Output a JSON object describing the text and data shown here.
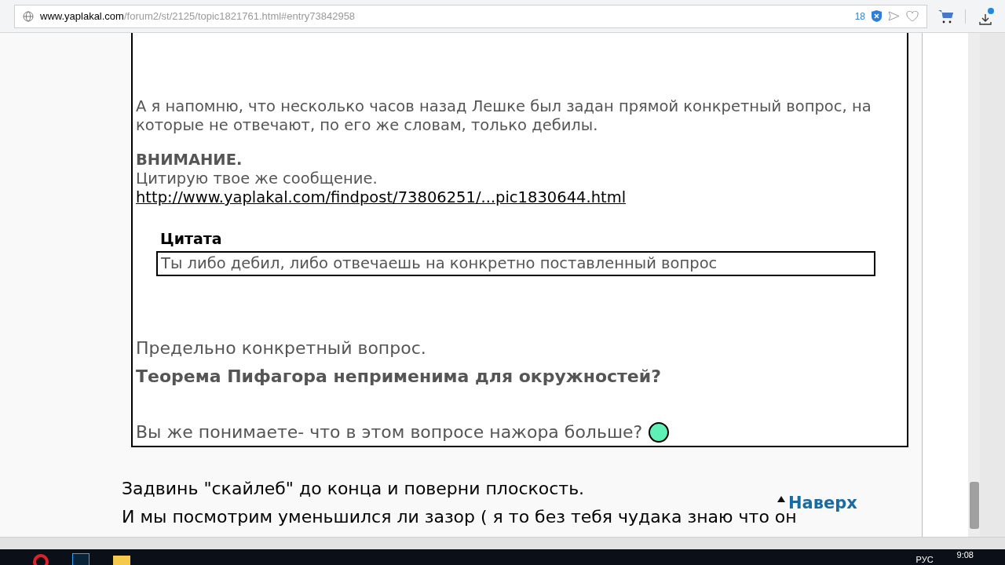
{
  "browser": {
    "url_host": "www.yaplakal.com",
    "url_path": "/forum2/st/2125/topic1821761.html#entry73842958",
    "blocked_count": "18",
    "downloads_badge": true
  },
  "quote": {
    "paragraphs": [
      {
        "kind": "text",
        "text": "А я напомню, что несколько часов назад Лешке был задан прямой конкретный вопрос, на которые не отвечают, по его же словам, только дебилы."
      },
      {
        "kind": "heading",
        "text": "ВНИМАНИЕ."
      },
      {
        "kind": "text",
        "text": "Цитирую твое же сообщение."
      },
      {
        "kind": "link",
        "text": "http://www.yaplakal.com/findpost/73806251/...pic1830644.html"
      },
      {
        "kind": "nested_quote",
        "title": "Цитата",
        "text": "Ты либо дебил, либо отвечаешь на конкретно поставленный вопрос"
      },
      {
        "kind": "large",
        "text": "Предельно конкретный вопрос."
      },
      {
        "kind": "large_bold",
        "text": "Теорема Пифагора неприменима для окружностей?"
      },
      {
        "kind": "large_smiley",
        "text": "Вы же понимаете- что в этом вопросе нажора больше?"
      }
    ]
  },
  "reply": [
    "Задвинь \"скайлеб\" до конца и поверни плоскость.",
    "И мы посмотрим уменьшился ли зазор ( я то без тебя чудака знаю что он"
  ],
  "to_top": "Наверх",
  "taskbar": {
    "language": "РУС",
    "time": "9:08"
  }
}
